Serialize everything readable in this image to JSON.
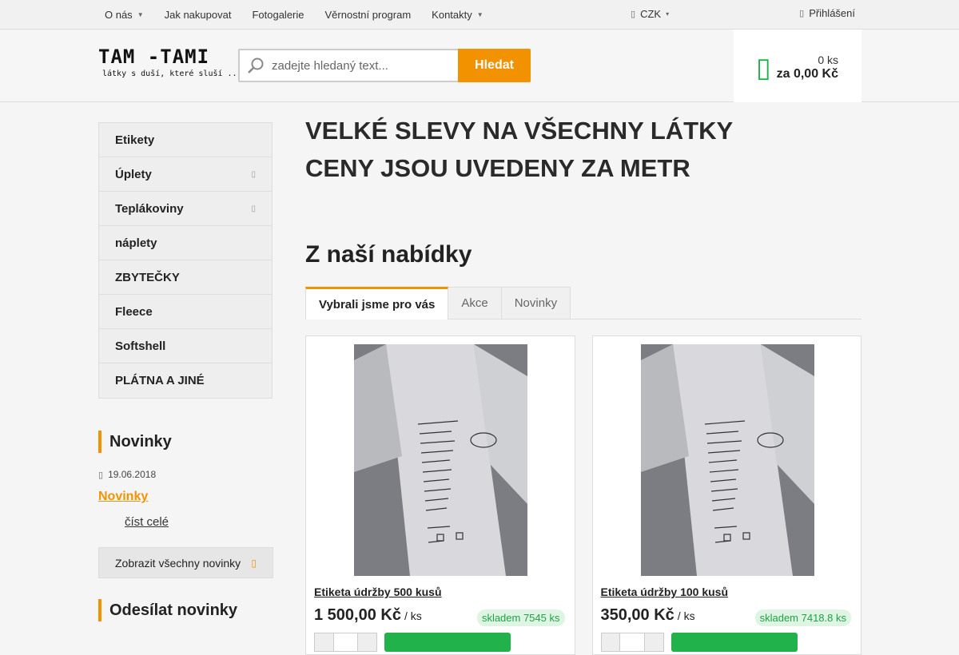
{
  "topnav": {
    "items": [
      {
        "label": "O nás",
        "has_dropdown": true
      },
      {
        "label": "Jak nakupovat"
      },
      {
        "label": "Fotogalerie"
      },
      {
        "label": "Věrnostní program"
      },
      {
        "label": "Kontakty",
        "has_dropdown": true
      }
    ],
    "currency": "CZK",
    "login": "Přihlášení"
  },
  "header": {
    "logo_title": "TAM -TAMI",
    "logo_subtitle": "látky s duší, které sluší ...",
    "search_placeholder": "zadejte hledaný text...",
    "search_button": "Hledat",
    "cart_count": "0 ks",
    "cart_total": "za 0,00 Kč"
  },
  "sidebar": {
    "categories": [
      {
        "label": "Etikety",
        "has_sub": false
      },
      {
        "label": "Úplety",
        "has_sub": true
      },
      {
        "label": "Teplákoviny",
        "has_sub": true
      },
      {
        "label": "náplety",
        "has_sub": false
      },
      {
        "label": "ZBYTEČKY",
        "has_sub": false
      },
      {
        "label": "Fleece",
        "has_sub": false
      },
      {
        "label": "Softshell",
        "has_sub": false
      },
      {
        "label": "PLÁTNA A JINÉ",
        "has_sub": false
      }
    ],
    "news_heading": "Novinky",
    "news_date": "19.06.2018",
    "news_title": "Novinky",
    "news_more": "číst celé",
    "all_news_button": "Zobrazit všechny novinky",
    "subscribe_heading": "Odesílat novinky"
  },
  "main": {
    "banner_line1": "VELKÉ SLEVY NA VŠECHNY LÁTKY",
    "banner_line2": "CENY JSOU UVEDENY ZA METR",
    "offer_heading": "Z naší nabídky",
    "tabs": [
      {
        "label": "Vybrali jsme pro vás",
        "active": true
      },
      {
        "label": "Akce",
        "active": false
      },
      {
        "label": "Novinky",
        "active": false
      }
    ],
    "products": [
      {
        "name": "Etiketa údržby 500 kusů",
        "price": "1 500,00 Kč",
        "unit": "/ ks",
        "stock": "skladem 7545 ks"
      },
      {
        "name": "Etiketa údržby 100 kusů",
        "price": "350,00 Kč",
        "unit": "/ ks",
        "stock": "skladem 7418.8 ks"
      }
    ]
  },
  "colors": {
    "accent": "#f39200",
    "green": "#21b24b"
  }
}
